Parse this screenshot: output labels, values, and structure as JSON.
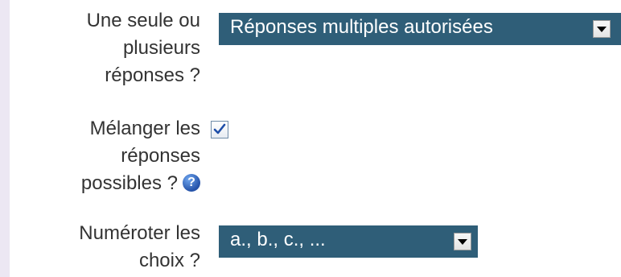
{
  "fields": {
    "answer_mode": {
      "label_lines": [
        "Une seule ou",
        "plusieurs",
        "réponses ?"
      ],
      "selected": "Réponses multiples autorisées"
    },
    "shuffle": {
      "label_lines": [
        "Mélanger les",
        "réponses",
        "possibles ?"
      ],
      "checked": true,
      "help_icon": "help-icon",
      "help_glyph": "?"
    },
    "numbering": {
      "label_lines": [
        "Numéroter les",
        "choix ?"
      ],
      "selected": "a., b., c., ..."
    }
  },
  "colors": {
    "select_bg": "#2f5e78",
    "label_text": "#333333",
    "left_strip": "#ece7f3",
    "help_icon": "#2f66c6",
    "checkmark": "#1e4ea8"
  }
}
